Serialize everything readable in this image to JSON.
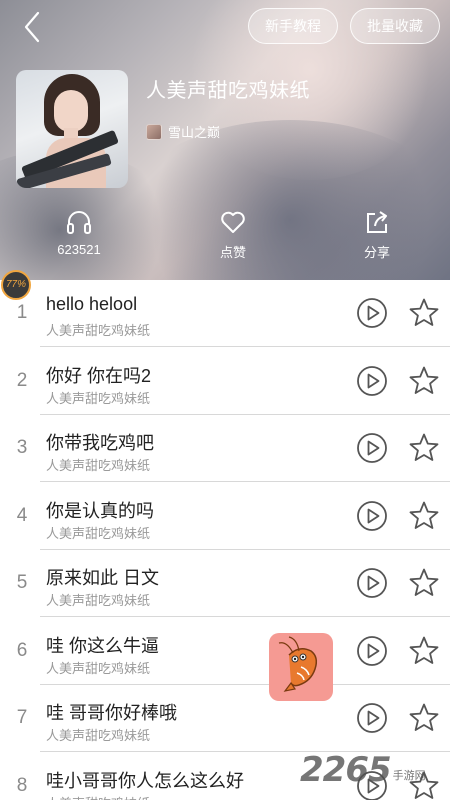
{
  "header": {
    "tutorial_label": "新手教程",
    "batch_collect_label": "批量收藏",
    "playlist_title": "人美声甜吃鸡妹纸",
    "author_name": "雪山之巅",
    "stats": {
      "plays_count": "623521",
      "like_label": "点赞",
      "share_label": "分享"
    }
  },
  "progress_badge": "77%",
  "songs": [
    {
      "index": "1",
      "title": "hello helool",
      "subtitle": "人美声甜吃鸡妹纸"
    },
    {
      "index": "2",
      "title": "你好 你在吗2",
      "subtitle": "人美声甜吃鸡妹纸"
    },
    {
      "index": "3",
      "title": "你带我吃鸡吧",
      "subtitle": "人美声甜吃鸡妹纸"
    },
    {
      "index": "4",
      "title": "你是认真的吗",
      "subtitle": "人美声甜吃鸡妹纸"
    },
    {
      "index": "5",
      "title": "原来如此 日文",
      "subtitle": "人美声甜吃鸡妹纸"
    },
    {
      "index": "6",
      "title": "哇 你这么牛逼",
      "subtitle": "人美声甜吃鸡妹纸"
    },
    {
      "index": "7",
      "title": "哇 哥哥你好棒哦",
      "subtitle": "人美声甜吃鸡妹纸"
    },
    {
      "index": "8",
      "title": "哇小哥哥你人怎么这么好",
      "subtitle": "人美声甜吃鸡妹纸"
    }
  ],
  "watermark": {
    "big": "2265",
    "small": "手游网"
  },
  "colors": {
    "float_button": "#f59a93",
    "badge_ring": "#f0a640",
    "icon_gray": "#555555"
  }
}
